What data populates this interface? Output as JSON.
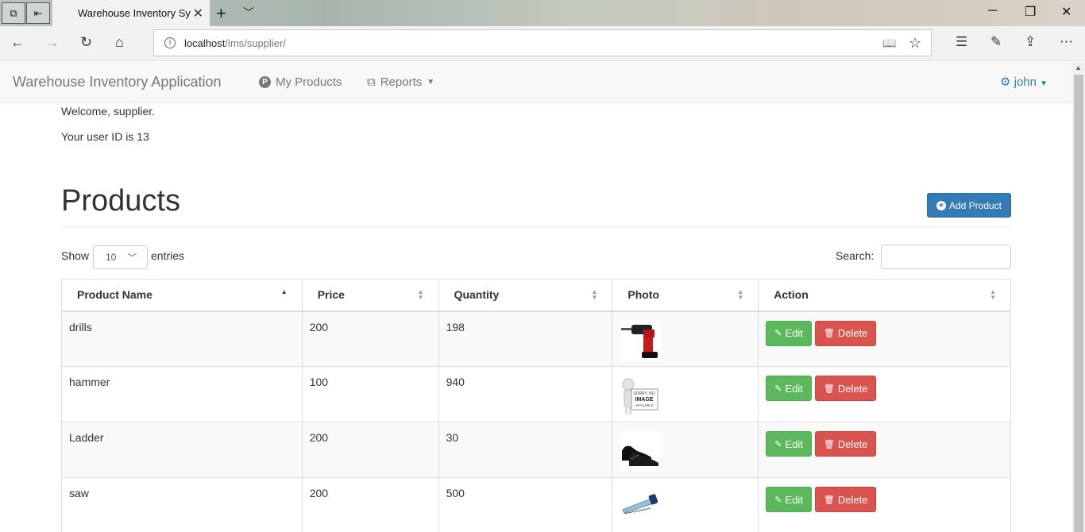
{
  "browser": {
    "tab_title": "Warehouse Inventory Sy",
    "url_host": "localhost",
    "url_path": "/ims/supplier/"
  },
  "navbar": {
    "brand": "Warehouse Inventory Application",
    "my_products": "My Products",
    "reports": "Reports",
    "user": "john"
  },
  "main": {
    "welcome": "Welcome, supplier.",
    "user_id_text": "Your user ID is 13",
    "heading": "Products",
    "add_button": "Add Product",
    "show_label": "Show",
    "entries_label": "entries",
    "page_length": "10",
    "search_label": "Search:"
  },
  "table": {
    "columns": [
      "Product Name",
      "Price",
      "Quantity",
      "Photo",
      "Action"
    ],
    "edit_label": "Edit",
    "delete_label": "Delete",
    "rows": [
      {
        "name": "drills",
        "price": "200",
        "quantity": "198",
        "photo": "drill"
      },
      {
        "name": "hammer",
        "price": "100",
        "quantity": "940",
        "photo": "no-image"
      },
      {
        "name": "Ladder",
        "price": "200",
        "quantity": "30",
        "photo": "shoes"
      },
      {
        "name": "saw",
        "price": "200",
        "quantity": "500",
        "photo": "saw"
      }
    ]
  },
  "thumb_texts": {
    "no_image_line1": "SORRY, NO",
    "no_image_line2": "IMAGE",
    "no_image_line3": "AVAILABLE"
  },
  "colors": {
    "primary": "#337ab7",
    "edit": "#5cb85c",
    "delete": "#d9534f"
  }
}
